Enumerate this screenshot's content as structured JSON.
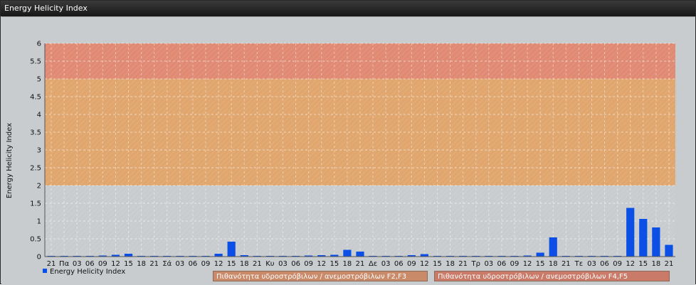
{
  "window": {
    "title": "Energy Helicity Index"
  },
  "colors": {
    "bar": "#0b4fe6",
    "zone_high": "#e08a74",
    "zone_mid": "#e0a66e",
    "zone_low": "#c9cccf",
    "legend_low": "#c98a6a",
    "legend_high": "#c97a68"
  },
  "legend": {
    "series_label": "Energy Helicity Index",
    "zone1_label": "Πιθανότητα υδροστρόβιλων / ανεμοστρόβιλων F2,F3",
    "zone2_label": "Πιθανότητα υδροστρόβιλων / ανεμοστρόβιλων F4,F5"
  },
  "chart_data": {
    "type": "bar",
    "title": "",
    "xlabel": "",
    "ylabel": "Energy Helicity Index",
    "ylim": [
      0,
      6
    ],
    "yticks": [
      0,
      0.5,
      1,
      1.5,
      2,
      2.5,
      3,
      3.5,
      4,
      4.5,
      5,
      5.5,
      6
    ],
    "yticks_labels": [
      "0",
      "0.5",
      "1",
      "1.5",
      "2",
      "2.5",
      "3",
      "3.5",
      "4",
      "4.5",
      "5",
      "5.5",
      "6"
    ],
    "grid": true,
    "legend_position": "bottom-left",
    "bands": [
      {
        "from": 0,
        "to": 2,
        "color": "#c9cccf"
      },
      {
        "from": 2,
        "to": 5,
        "color": "#e0a66e"
      },
      {
        "from": 5,
        "to": 6,
        "color": "#e08a74"
      }
    ],
    "categories": [
      "21",
      "Πα",
      "03",
      "06",
      "09",
      "12",
      "15",
      "18",
      "21",
      "Σά",
      "03",
      "06",
      "09",
      "12",
      "15",
      "18",
      "21",
      "Κυ",
      "03",
      "06",
      "09",
      "12",
      "15",
      "18",
      "21",
      "Δε",
      "03",
      "06",
      "09",
      "12",
      "15",
      "18",
      "21",
      "Τρ",
      "03",
      "06",
      "09",
      "12",
      "15",
      "18",
      "21",
      "Τε",
      "03",
      "06",
      "09",
      "12",
      "15",
      "18",
      "21"
    ],
    "series": [
      {
        "name": "Energy Helicity Index",
        "values": [
          0.02,
          0.02,
          0.02,
          0.02,
          0.03,
          0.05,
          0.08,
          0.02,
          0.02,
          0.02,
          0.02,
          0.02,
          0.02,
          0.08,
          0.42,
          0.04,
          0.02,
          0.02,
          0.02,
          0.02,
          0.03,
          0.04,
          0.05,
          0.19,
          0.14,
          0.02,
          0.02,
          0.02,
          0.04,
          0.07,
          0.02,
          0.02,
          0.02,
          0.02,
          0.02,
          0.02,
          0.02,
          0.03,
          0.11,
          0.54,
          0.02,
          0.02,
          0.02,
          0.02,
          0.02,
          1.37,
          1.06,
          0.82,
          0.33,
          0.06
        ]
      }
    ]
  }
}
